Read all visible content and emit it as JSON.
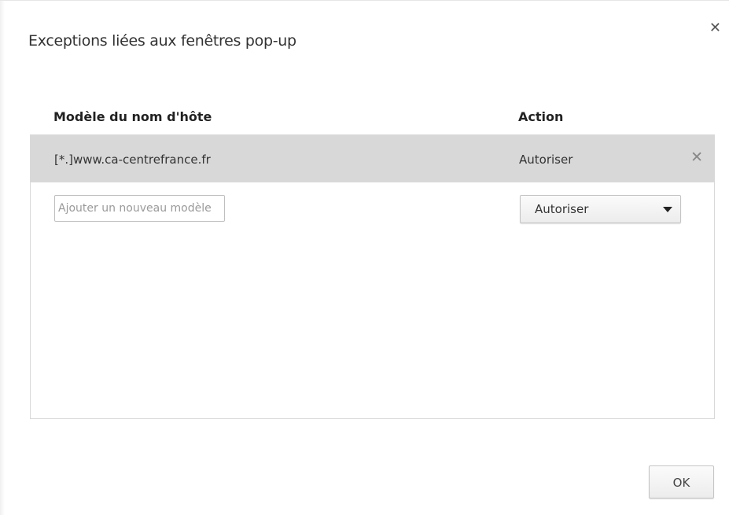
{
  "dialog": {
    "title": "Exceptions liées aux fenêtres pop-up",
    "close_icon": "close-icon"
  },
  "table": {
    "headers": {
      "host_pattern": "Modèle du nom d'hôte",
      "action": "Action"
    },
    "rows": [
      {
        "host": "[*.]www.ca-centrefrance.fr",
        "action": "Autoriser",
        "remove_icon": "remove-icon",
        "selected": true
      }
    ],
    "new_entry": {
      "placeholder": "Ajouter un nouveau modèle",
      "value": "",
      "action_selected": "Autoriser"
    }
  },
  "footer": {
    "ok_label": "OK"
  },
  "colors": {
    "selected_row": "#d8d8d8",
    "border": "#d9d9d9",
    "text": "#333333"
  }
}
